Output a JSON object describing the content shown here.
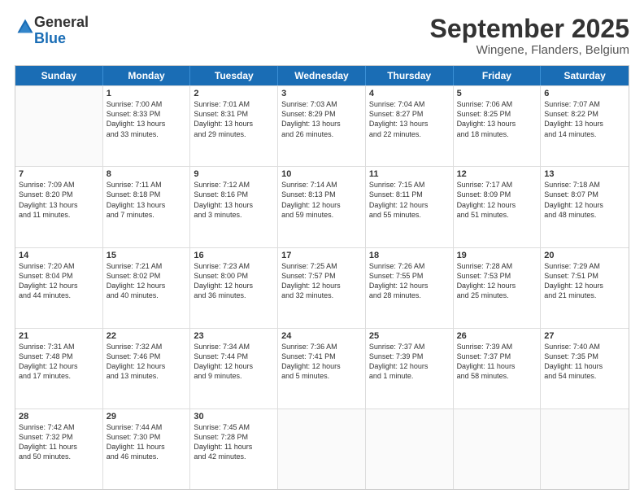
{
  "logo": {
    "general": "General",
    "blue": "Blue"
  },
  "title": "September 2025",
  "subtitle": "Wingene, Flanders, Belgium",
  "weekdays": [
    "Sunday",
    "Monday",
    "Tuesday",
    "Wednesday",
    "Thursday",
    "Friday",
    "Saturday"
  ],
  "weeks": [
    [
      {
        "day": "",
        "lines": []
      },
      {
        "day": "1",
        "lines": [
          "Sunrise: 7:00 AM",
          "Sunset: 8:33 PM",
          "Daylight: 13 hours",
          "and 33 minutes."
        ]
      },
      {
        "day": "2",
        "lines": [
          "Sunrise: 7:01 AM",
          "Sunset: 8:31 PM",
          "Daylight: 13 hours",
          "and 29 minutes."
        ]
      },
      {
        "day": "3",
        "lines": [
          "Sunrise: 7:03 AM",
          "Sunset: 8:29 PM",
          "Daylight: 13 hours",
          "and 26 minutes."
        ]
      },
      {
        "day": "4",
        "lines": [
          "Sunrise: 7:04 AM",
          "Sunset: 8:27 PM",
          "Daylight: 13 hours",
          "and 22 minutes."
        ]
      },
      {
        "day": "5",
        "lines": [
          "Sunrise: 7:06 AM",
          "Sunset: 8:25 PM",
          "Daylight: 13 hours",
          "and 18 minutes."
        ]
      },
      {
        "day": "6",
        "lines": [
          "Sunrise: 7:07 AM",
          "Sunset: 8:22 PM",
          "Daylight: 13 hours",
          "and 14 minutes."
        ]
      }
    ],
    [
      {
        "day": "7",
        "lines": [
          "Sunrise: 7:09 AM",
          "Sunset: 8:20 PM",
          "Daylight: 13 hours",
          "and 11 minutes."
        ]
      },
      {
        "day": "8",
        "lines": [
          "Sunrise: 7:11 AM",
          "Sunset: 8:18 PM",
          "Daylight: 13 hours",
          "and 7 minutes."
        ]
      },
      {
        "day": "9",
        "lines": [
          "Sunrise: 7:12 AM",
          "Sunset: 8:16 PM",
          "Daylight: 13 hours",
          "and 3 minutes."
        ]
      },
      {
        "day": "10",
        "lines": [
          "Sunrise: 7:14 AM",
          "Sunset: 8:13 PM",
          "Daylight: 12 hours",
          "and 59 minutes."
        ]
      },
      {
        "day": "11",
        "lines": [
          "Sunrise: 7:15 AM",
          "Sunset: 8:11 PM",
          "Daylight: 12 hours",
          "and 55 minutes."
        ]
      },
      {
        "day": "12",
        "lines": [
          "Sunrise: 7:17 AM",
          "Sunset: 8:09 PM",
          "Daylight: 12 hours",
          "and 51 minutes."
        ]
      },
      {
        "day": "13",
        "lines": [
          "Sunrise: 7:18 AM",
          "Sunset: 8:07 PM",
          "Daylight: 12 hours",
          "and 48 minutes."
        ]
      }
    ],
    [
      {
        "day": "14",
        "lines": [
          "Sunrise: 7:20 AM",
          "Sunset: 8:04 PM",
          "Daylight: 12 hours",
          "and 44 minutes."
        ]
      },
      {
        "day": "15",
        "lines": [
          "Sunrise: 7:21 AM",
          "Sunset: 8:02 PM",
          "Daylight: 12 hours",
          "and 40 minutes."
        ]
      },
      {
        "day": "16",
        "lines": [
          "Sunrise: 7:23 AM",
          "Sunset: 8:00 PM",
          "Daylight: 12 hours",
          "and 36 minutes."
        ]
      },
      {
        "day": "17",
        "lines": [
          "Sunrise: 7:25 AM",
          "Sunset: 7:57 PM",
          "Daylight: 12 hours",
          "and 32 minutes."
        ]
      },
      {
        "day": "18",
        "lines": [
          "Sunrise: 7:26 AM",
          "Sunset: 7:55 PM",
          "Daylight: 12 hours",
          "and 28 minutes."
        ]
      },
      {
        "day": "19",
        "lines": [
          "Sunrise: 7:28 AM",
          "Sunset: 7:53 PM",
          "Daylight: 12 hours",
          "and 25 minutes."
        ]
      },
      {
        "day": "20",
        "lines": [
          "Sunrise: 7:29 AM",
          "Sunset: 7:51 PM",
          "Daylight: 12 hours",
          "and 21 minutes."
        ]
      }
    ],
    [
      {
        "day": "21",
        "lines": [
          "Sunrise: 7:31 AM",
          "Sunset: 7:48 PM",
          "Daylight: 12 hours",
          "and 17 minutes."
        ]
      },
      {
        "day": "22",
        "lines": [
          "Sunrise: 7:32 AM",
          "Sunset: 7:46 PM",
          "Daylight: 12 hours",
          "and 13 minutes."
        ]
      },
      {
        "day": "23",
        "lines": [
          "Sunrise: 7:34 AM",
          "Sunset: 7:44 PM",
          "Daylight: 12 hours",
          "and 9 minutes."
        ]
      },
      {
        "day": "24",
        "lines": [
          "Sunrise: 7:36 AM",
          "Sunset: 7:41 PM",
          "Daylight: 12 hours",
          "and 5 minutes."
        ]
      },
      {
        "day": "25",
        "lines": [
          "Sunrise: 7:37 AM",
          "Sunset: 7:39 PM",
          "Daylight: 12 hours",
          "and 1 minute."
        ]
      },
      {
        "day": "26",
        "lines": [
          "Sunrise: 7:39 AM",
          "Sunset: 7:37 PM",
          "Daylight: 11 hours",
          "and 58 minutes."
        ]
      },
      {
        "day": "27",
        "lines": [
          "Sunrise: 7:40 AM",
          "Sunset: 7:35 PM",
          "Daylight: 11 hours",
          "and 54 minutes."
        ]
      }
    ],
    [
      {
        "day": "28",
        "lines": [
          "Sunrise: 7:42 AM",
          "Sunset: 7:32 PM",
          "Daylight: 11 hours",
          "and 50 minutes."
        ]
      },
      {
        "day": "29",
        "lines": [
          "Sunrise: 7:44 AM",
          "Sunset: 7:30 PM",
          "Daylight: 11 hours",
          "and 46 minutes."
        ]
      },
      {
        "day": "30",
        "lines": [
          "Sunrise: 7:45 AM",
          "Sunset: 7:28 PM",
          "Daylight: 11 hours",
          "and 42 minutes."
        ]
      },
      {
        "day": "",
        "lines": []
      },
      {
        "day": "",
        "lines": []
      },
      {
        "day": "",
        "lines": []
      },
      {
        "day": "",
        "lines": []
      }
    ]
  ]
}
